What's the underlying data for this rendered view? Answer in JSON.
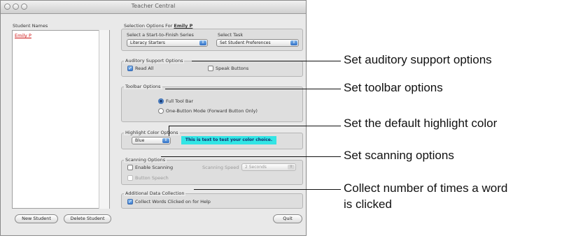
{
  "window": {
    "title": "Teacher Central"
  },
  "students": {
    "header": "Student Names",
    "items": [
      "Emily P"
    ]
  },
  "selection": {
    "prefix": "Selection Options For",
    "student": "Emily P",
    "series_label": "Select a Start-to-Finish Series",
    "series_value": "Literacy Starters",
    "task_label": "Select Task",
    "task_value": "Set Student Preferences"
  },
  "auditory": {
    "title": "Auditory Support Options",
    "read_all": "Read All",
    "speak_buttons": "Speak Buttons"
  },
  "toolbar": {
    "title": "Toolbar Options",
    "full": "Full Tool Bar",
    "one_button": "One-Button Mode (Forward Button Only)"
  },
  "highlight": {
    "title": "Highlight Color Options",
    "value": "Blue",
    "sample": "This is text to test your color choice.",
    "sample_color": "#32e5e5"
  },
  "scanning": {
    "title": "Scanning Options",
    "enable": "Enable Scanning",
    "speed_label": "Scanning Speed",
    "speed_value": "2 Seconds",
    "button_speech": "Button Speech"
  },
  "additional": {
    "title": "Additional Data Collection",
    "collect": "Collect Words Clicked on for Help"
  },
  "buttons": {
    "new_student": "New Student",
    "delete_student": "Delete Student",
    "quit": "Quit"
  },
  "callouts": {
    "auditory": "Set auditory support options",
    "toolbar": "Set toolbar options",
    "highlight": "Set the default highlight color",
    "scanning": "Set scanning options",
    "collect_1": "Collect number of times a word",
    "collect_2": "is clicked"
  }
}
